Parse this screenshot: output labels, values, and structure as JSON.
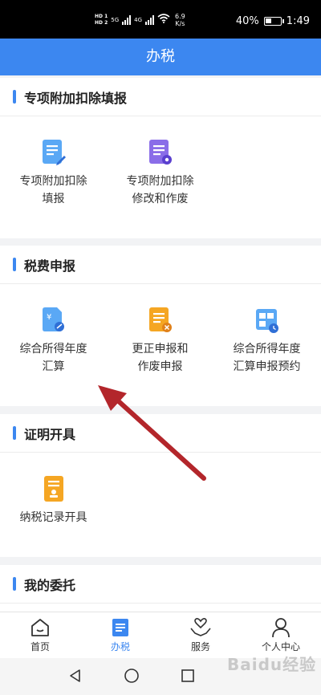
{
  "status_bar": {
    "hd1": "HD 1",
    "hd2": "HD 2",
    "net1": "5G",
    "net2": "4G",
    "speed_value": "6.9",
    "speed_unit": "K/s",
    "battery": "40%",
    "battery_level": 0.4,
    "time": "1:49"
  },
  "header": {
    "title": "办税"
  },
  "sections": [
    {
      "title": "专项附加扣除填报",
      "items": [
        {
          "line1": "专项附加扣除",
          "line2": "填报",
          "icon": "edit-document-icon"
        },
        {
          "line1": "专项附加扣除",
          "line2": "修改和作废",
          "icon": "settings-document-icon"
        }
      ]
    },
    {
      "title": "税费申报",
      "items": [
        {
          "line1": "综合所得年度",
          "line2": "汇算",
          "icon": "yuan-document-icon"
        },
        {
          "line1": "更正申报和",
          "line2": "作废申报",
          "icon": "cancel-document-icon"
        },
        {
          "line1": "综合所得年度",
          "line2": "汇算申报预约",
          "icon": "calendar-clock-icon"
        }
      ]
    },
    {
      "title": "证明开具",
      "items": [
        {
          "line1": "纳税记录开具",
          "line2": "",
          "icon": "certificate-icon"
        }
      ]
    },
    {
      "title": "我的委托",
      "items": []
    }
  ],
  "tabs": [
    {
      "label": "首页",
      "icon": "home-icon",
      "active": false
    },
    {
      "label": "办税",
      "icon": "tax-document-icon",
      "active": true
    },
    {
      "label": "服务",
      "icon": "heart-hands-icon",
      "active": false
    },
    {
      "label": "个人中心",
      "icon": "person-icon",
      "active": false
    }
  ],
  "watermark": "Baidu经验",
  "colors": {
    "primary": "#3c87f0",
    "annotation_arrow": "#b3262b"
  }
}
